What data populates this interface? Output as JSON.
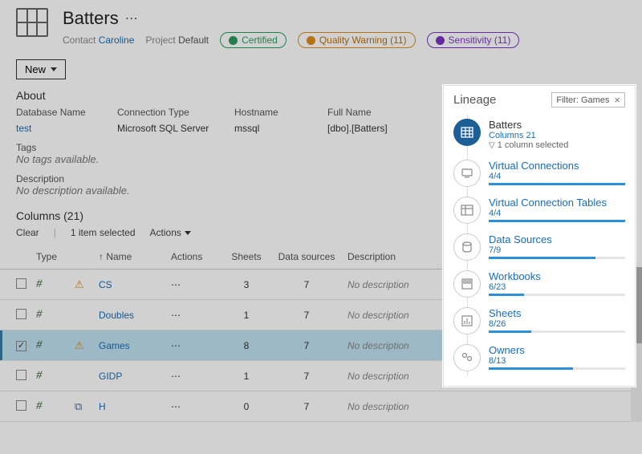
{
  "header": {
    "title": "Batters",
    "contact_label": "Contact",
    "contact_value": "Caroline",
    "project_label": "Project",
    "project_value": "Default",
    "badges": {
      "certified": "Certified",
      "warning": "Quality Warning (11)",
      "sensitivity": "Sensitivity (11)"
    },
    "new_button": "New"
  },
  "about": {
    "heading": "About",
    "db_label": "Database Name",
    "db_value": "test",
    "conn_label": "Connection Type",
    "conn_value": "Microsoft SQL Server",
    "host_label": "Hostname",
    "host_value": "mssql",
    "full_label": "Full Name",
    "full_value": "[dbo].[Batters]",
    "tags_label": "Tags",
    "tags_value": "No tags available.",
    "desc_label": "Description",
    "desc_value": "No description available."
  },
  "columns": {
    "heading": "Columns (21)",
    "clear": "Clear",
    "selected": "1 item selected",
    "actions": "Actions",
    "headers": {
      "type": "Type",
      "name": "Name",
      "actions": "Actions",
      "sheets": "Sheets",
      "datasources": "Data sources",
      "description": "Description"
    },
    "rows": [
      {
        "name": "CS",
        "sheets": "3",
        "ds": "7",
        "desc": "No description",
        "warn": true,
        "selected": false
      },
      {
        "name": "Doubles",
        "sheets": "1",
        "ds": "7",
        "desc": "No description",
        "warn": false,
        "selected": false
      },
      {
        "name": "Games",
        "sheets": "8",
        "ds": "7",
        "desc": "No description",
        "warn": true,
        "selected": true
      },
      {
        "name": "GIDP",
        "sheets": "1",
        "ds": "7",
        "desc": "No description",
        "warn": false,
        "selected": false
      },
      {
        "name": "H",
        "sheets": "0",
        "ds": "7",
        "desc": "No description",
        "warn": false,
        "link": true,
        "selected": false
      }
    ]
  },
  "lineage": {
    "heading": "Lineage",
    "filter_label": "Filter: Games",
    "primary": {
      "title": "Batters",
      "sub1": "Columns 21",
      "sub2": "1 column selected"
    },
    "items": [
      {
        "title": "Virtual Connections",
        "count": "4/4",
        "pct": 100
      },
      {
        "title": "Virtual Connection Tables",
        "count": "4/4",
        "pct": 100
      },
      {
        "title": "Data Sources",
        "count": "7/9",
        "pct": 78
      },
      {
        "title": "Workbooks",
        "count": "6/23",
        "pct": 26
      },
      {
        "title": "Sheets",
        "count": "8/26",
        "pct": 31
      },
      {
        "title": "Owners",
        "count": "8/13",
        "pct": 62
      }
    ]
  }
}
